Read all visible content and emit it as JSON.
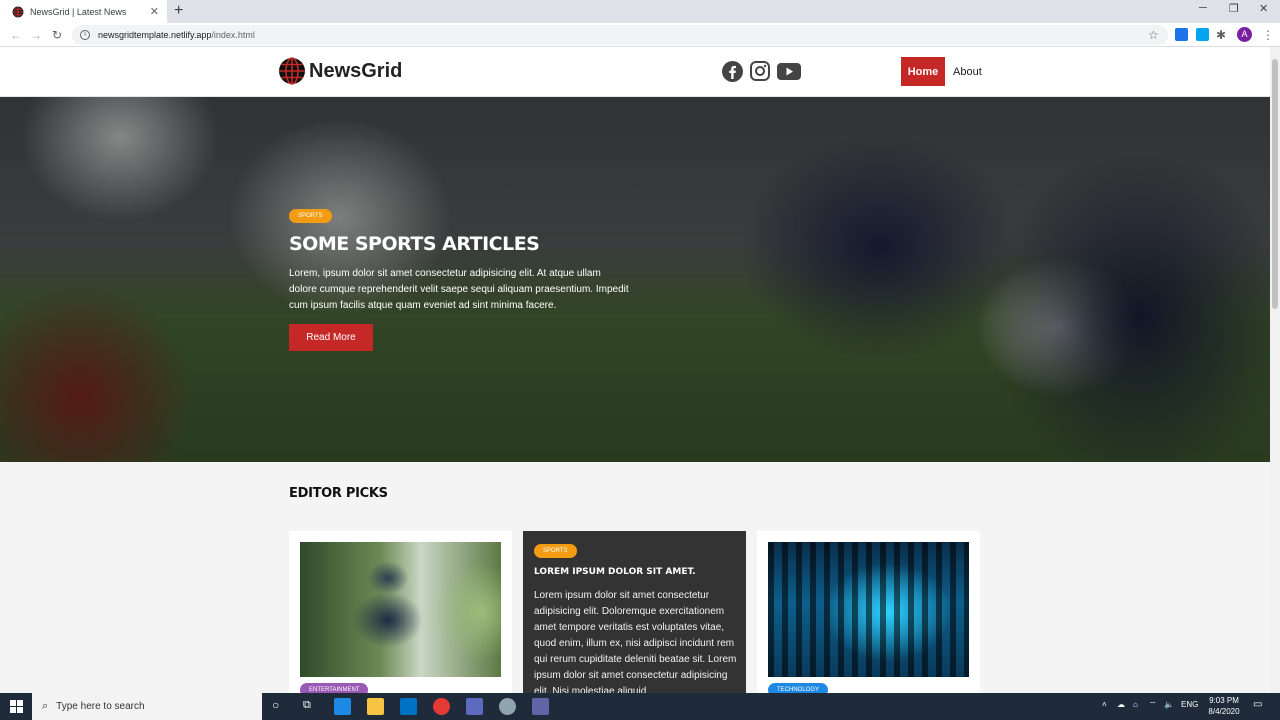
{
  "browser": {
    "tab_title": "NewsGrid | Latest News",
    "tab_close": "✕",
    "new_tab": "+",
    "url_host": "newsgridtemplate.netlify.app",
    "url_path": "/index.html",
    "avatar_letter": "A"
  },
  "site": {
    "brand": "NewsGrid",
    "social": [
      "facebook-icon",
      "instagram-icon",
      "youtube-icon"
    ],
    "nav": {
      "home": "Home",
      "about": "About"
    },
    "accent": "#c62828"
  },
  "hero": {
    "category": "Sports",
    "title": "Some Sports Articles",
    "text": "Lorem, ipsum dolor sit amet consectetur adipisicing elit. At atque ullam dolore cumque reprehenderit velit saepe sequi aliquam praesentium. Impedit cum ipsum facilis atque quam eveniet ad sint minima facere.",
    "button": "Read More"
  },
  "picks": {
    "title": "Editor Picks",
    "cards": [
      {
        "category": "Entertainment",
        "badge_color": "#9b59b6"
      },
      {
        "category": "Sports",
        "badge_color": "#f39c12",
        "title": "Lorem ipsum dolor sit amet.",
        "text": "Lorem ipsum dolor sit amet consectetur adipisicing elit. Doloremque exercitationem amet tempore veritatis est voluptates vitae, quod enim, illum ex, nisi adipisci incidunt rem qui rerum cupiditate deleniti beatae sit. Lorem ipsum dolor sit amet consectetur adipisicing elit. Nisi molestiae aliquid"
      },
      {
        "category": "Technology",
        "badge_color": "#1e88e5"
      }
    ]
  },
  "taskbar": {
    "search_placeholder": "Type here to search",
    "language": "ENG",
    "time": "9:03 PM",
    "date": "8/4/2020"
  }
}
